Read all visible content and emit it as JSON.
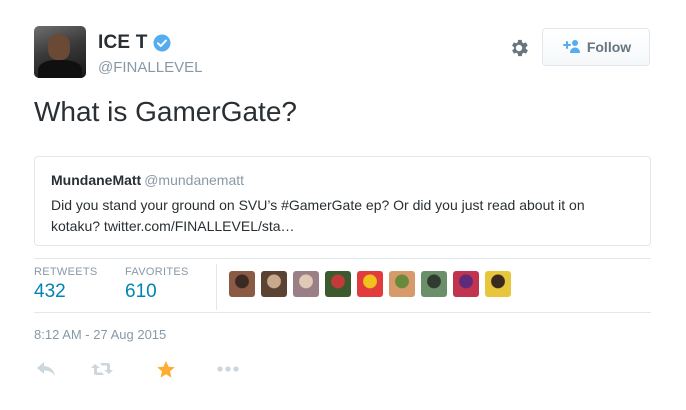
{
  "author": {
    "name": "ICE T",
    "handle": "@FINALLEVEL",
    "verified": true,
    "avatar_icon": "user-avatar"
  },
  "header": {
    "settings_icon": "gear-icon",
    "follow_label": "Follow",
    "follow_icon": "add-user-icon"
  },
  "tweet": {
    "text": "What is GamerGate?",
    "timestamp": "8:12 AM - 27 Aug 2015"
  },
  "quoted_tweet": {
    "name": "MundaneMatt",
    "handle": "@mundanematt",
    "text": "Did you stand your ground on SVU’s #GamerGate ep? Or did you just read about it on kotaku? twitter.com/FINALLEVEL/sta…"
  },
  "stats": {
    "retweets_label": "RETWEETS",
    "retweets_count": "432",
    "favorites_label": "FAVORITES",
    "favorites_count": "610"
  },
  "favoriters": [
    {
      "color_a": "#8a5a44",
      "color_b": "#3b2a22"
    },
    {
      "color_a": "#5b4334",
      "color_b": "#c9a98e"
    },
    {
      "color_a": "#9b7f86",
      "color_b": "#e2c9b6"
    },
    {
      "color_a": "#3d5a2e",
      "color_b": "#c23a3a"
    },
    {
      "color_a": "#e23b3b",
      "color_b": "#f2c21c"
    },
    {
      "color_a": "#d79a6b",
      "color_b": "#6a8a3b"
    },
    {
      "color_a": "#6b8e6b",
      "color_b": "#2e3b2e"
    },
    {
      "color_a": "#c0344f",
      "color_b": "#5e2a7a"
    },
    {
      "color_a": "#e8c63c",
      "color_b": "#3a2a1e"
    }
  ],
  "actions": [
    {
      "name": "reply-icon"
    },
    {
      "name": "retweet-icon"
    },
    {
      "name": "favorite-star-icon",
      "color": "#ffac33"
    },
    {
      "name": "more-dots-icon"
    }
  ],
  "colors": {
    "link_blue": "#0084b4",
    "verified_blue": "#55acee",
    "secondary_text": "#8899a6",
    "action_gray": "#ccd6dd",
    "favorite_gold": "#ffac33"
  }
}
